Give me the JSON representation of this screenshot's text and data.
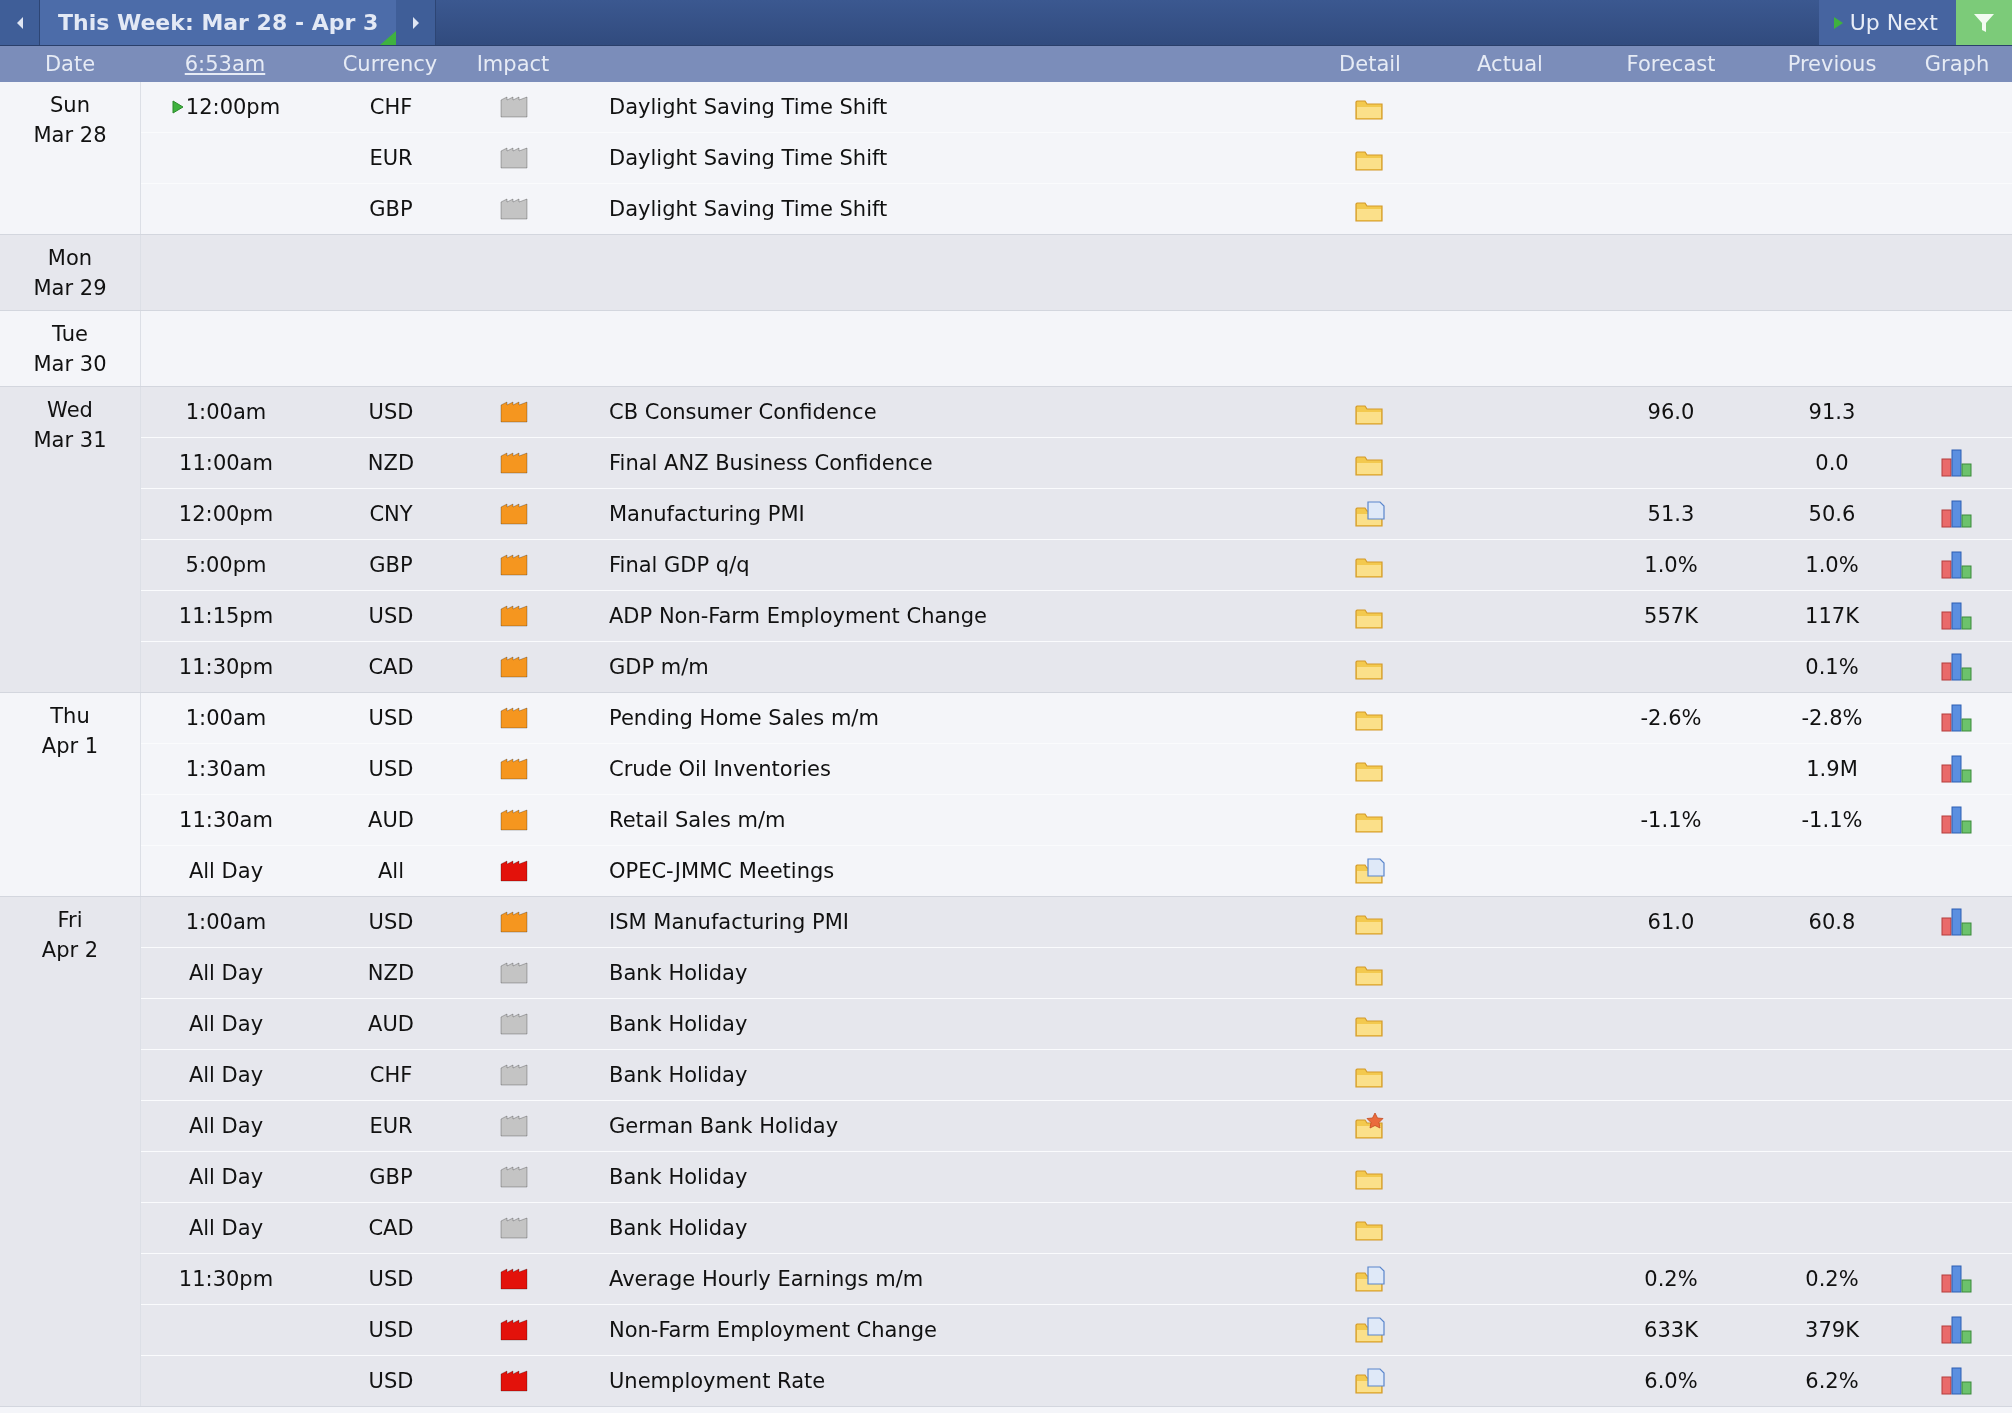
{
  "toolbar": {
    "title": "This Week: Mar 28 - Apr 3",
    "up_next": "Up Next"
  },
  "columns": [
    {
      "label": "Date",
      "kind": "text"
    },
    {
      "label": "6:53am",
      "kind": "link"
    },
    {
      "label": "Currency",
      "kind": "text"
    },
    {
      "label": "Impact",
      "kind": "text"
    },
    {
      "kind": "blank"
    },
    {
      "label": "Detail",
      "kind": "text"
    },
    {
      "label": "Actual",
      "kind": "text"
    },
    {
      "label": "Forecast",
      "kind": "text"
    },
    {
      "label": "Previous",
      "kind": "text"
    },
    {
      "label": "Graph",
      "kind": "text"
    }
  ],
  "days": [
    {
      "day": "Sun",
      "date": "Mar 28",
      "events": [
        {
          "time": "12:00pm",
          "next": true,
          "currency": "CHF",
          "color": "#c4c4c4",
          "title": "Daylight Saving Time Shift",
          "kind": "folder",
          "graph": false
        },
        {
          "next": false,
          "currency": "EUR",
          "color": "#c4c4c4",
          "title": "Daylight Saving Time Shift",
          "kind": "folder",
          "graph": false
        },
        {
          "next": false,
          "currency": "GBP",
          "color": "#c4c4c4",
          "title": "Daylight Saving Time Shift",
          "kind": "folder",
          "graph": false
        }
      ]
    },
    {
      "day": "Mon",
      "date": "Mar 29"
    },
    {
      "day": "Tue",
      "date": "Mar 30"
    },
    {
      "day": "Wed",
      "date": "Mar 31",
      "events": [
        {
          "time": "1:00am",
          "next": false,
          "currency": "USD",
          "color": "#f5961f",
          "title": "CB Consumer Confidence",
          "kind": "folder",
          "forecast": "96.0",
          "previous": "91.3",
          "graph": false
        },
        {
          "time": "11:00am",
          "next": false,
          "currency": "NZD",
          "color": "#f5961f",
          "title": "Final ANZ Business Confidence",
          "kind": "folder",
          "previous": "0.0",
          "graph": true
        },
        {
          "time": "12:00pm",
          "next": false,
          "currency": "CNY",
          "color": "#f5961f",
          "title": "Manufacturing PMI",
          "kind": "folder-doc",
          "forecast": "51.3",
          "previous": "50.6",
          "graph": true
        },
        {
          "time": "5:00pm",
          "next": false,
          "currency": "GBP",
          "color": "#f5961f",
          "title": "Final GDP q/q",
          "kind": "folder",
          "forecast": "1.0%",
          "previous": "1.0%",
          "graph": true
        },
        {
          "time": "11:15pm",
          "next": false,
          "currency": "USD",
          "color": "#f5961f",
          "title": "ADP Non-Farm Employment Change",
          "kind": "folder",
          "forecast": "557K",
          "previous": "117K",
          "graph": true
        },
        {
          "time": "11:30pm",
          "next": false,
          "currency": "CAD",
          "color": "#f5961f",
          "title": "GDP m/m",
          "kind": "folder",
          "previous": "0.1%",
          "graph": true
        }
      ]
    },
    {
      "day": "Thu",
      "date": "Apr 1",
      "events": [
        {
          "time": "1:00am",
          "next": false,
          "currency": "USD",
          "color": "#f5961f",
          "title": "Pending Home Sales m/m",
          "kind": "folder",
          "forecast": "-2.6%",
          "previous": "-2.8%",
          "graph": true
        },
        {
          "time": "1:30am",
          "next": false,
          "currency": "USD",
          "color": "#f5961f",
          "title": "Crude Oil Inventories",
          "kind": "folder",
          "previous": "1.9M",
          "graph": true
        },
        {
          "time": "11:30am",
          "next": false,
          "currency": "AUD",
          "color": "#f5961f",
          "title": "Retail Sales m/m",
          "kind": "folder",
          "forecast": "-1.1%",
          "previous": "-1.1%",
          "graph": true
        },
        {
          "time": "All Day",
          "next": false,
          "currency": "All",
          "color": "#e3120b",
          "title": "OPEC-JMMC Meetings",
          "kind": "folder-doc",
          "graph": false
        }
      ]
    },
    {
      "day": "Fri",
      "date": "Apr 2",
      "events": [
        {
          "time": "1:00am",
          "next": false,
          "currency": "USD",
          "color": "#f5961f",
          "title": "ISM Manufacturing PMI",
          "kind": "folder",
          "forecast": "61.0",
          "previous": "60.8",
          "graph": true
        },
        {
          "time": "All Day",
          "next": false,
          "currency": "NZD",
          "color": "#c4c4c4",
          "title": "Bank Holiday",
          "kind": "folder",
          "graph": false
        },
        {
          "time": "All Day",
          "next": false,
          "currency": "AUD",
          "color": "#c4c4c4",
          "title": "Bank Holiday",
          "kind": "folder",
          "graph": false
        },
        {
          "time": "All Day",
          "next": false,
          "currency": "CHF",
          "color": "#c4c4c4",
          "title": "Bank Holiday",
          "kind": "folder",
          "graph": false
        },
        {
          "time": "All Day",
          "next": false,
          "currency": "EUR",
          "color": "#c4c4c4",
          "title": "German Bank Holiday",
          "kind": "folder-star",
          "graph": false
        },
        {
          "time": "All Day",
          "next": false,
          "currency": "GBP",
          "color": "#c4c4c4",
          "title": "Bank Holiday",
          "kind": "folder",
          "graph": false
        },
        {
          "time": "All Day",
          "next": false,
          "currency": "CAD",
          "color": "#c4c4c4",
          "title": "Bank Holiday",
          "kind": "folder",
          "graph": false
        },
        {
          "time": "11:30pm",
          "next": false,
          "currency": "USD",
          "color": "#e3120b",
          "title": "Average Hourly Earnings m/m",
          "kind": "folder-doc",
          "forecast": "0.2%",
          "previous": "0.2%",
          "graph": true
        },
        {
          "next": false,
          "currency": "USD",
          "color": "#e3120b",
          "title": "Non-Farm Employment Change",
          "kind": "folder-doc",
          "forecast": "633K",
          "previous": "379K",
          "graph": true
        },
        {
          "next": false,
          "currency": "USD",
          "color": "#e3120b",
          "title": "Unemployment Rate",
          "kind": "folder-doc",
          "forecast": "6.0%",
          "previous": "6.2%",
          "graph": true
        }
      ]
    }
  ]
}
